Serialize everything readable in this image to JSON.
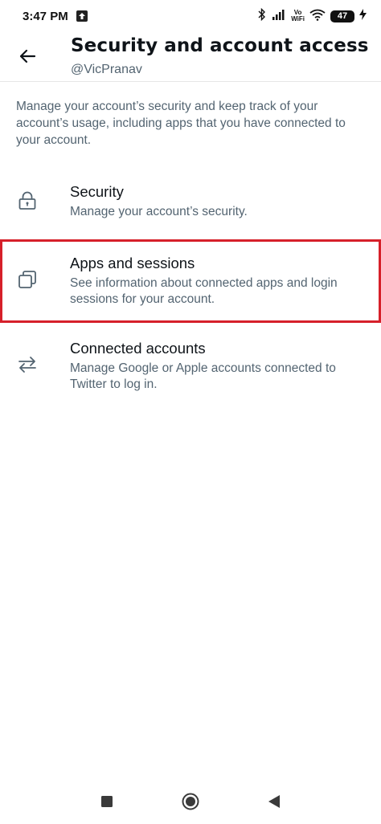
{
  "status_bar": {
    "time": "3:47 PM",
    "network_label_top": "Vo",
    "network_label_bottom": "WiFi",
    "battery": "47"
  },
  "header": {
    "title": "Security and account access",
    "handle": "@VicPranav"
  },
  "intro_text": "Manage your account’s security and keep track of your account’s usage, including apps that you have connected to your account.",
  "menu": {
    "items": [
      {
        "title": "Security",
        "description": "Manage your account’s security.",
        "icon": "lock-icon"
      },
      {
        "title": "Apps and sessions",
        "description": "See information about connected apps and login sessions for your account.",
        "icon": "copy-windows-icon",
        "highlighted": true,
        "highlight_color": "#d6202a"
      },
      {
        "title": "Connected accounts",
        "description": "Manage Google or Apple accounts connected to Twitter to log in.",
        "icon": "swap-arrows-icon"
      }
    ]
  },
  "nav_bar": {
    "buttons": [
      "recents-square-icon",
      "home-circle-icon",
      "back-triangle-icon"
    ]
  },
  "colors": {
    "primary_text": "#0f1419",
    "secondary_text": "#536471",
    "highlight": "#d6202a"
  }
}
